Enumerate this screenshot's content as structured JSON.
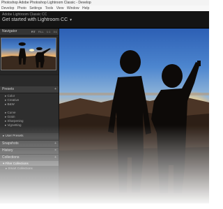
{
  "window": {
    "title": "Photoshop Adobe Photoshop Lightroom Classic - Develop",
    "menu": [
      "Develop",
      "Photo",
      "Settings",
      "Tools",
      "View",
      "Window",
      "Help"
    ]
  },
  "identity": {
    "subtitle": "Adobe Lightroom Classic CC",
    "title": "Get started with Lightroom CC"
  },
  "navigator": {
    "label": "Navigator",
    "zoom": [
      "FIT",
      "FILL",
      "1:1",
      "3:1"
    ],
    "zoom_active": "FIT"
  },
  "presets": {
    "label": "Presets",
    "add": "+",
    "items": [
      {
        "label": "Color",
        "child": true
      },
      {
        "label": "Creative",
        "child": true
      },
      {
        "label": "B&W",
        "child": true
      },
      {
        "label": "",
        "child": false
      },
      {
        "label": "Curve",
        "child": true
      },
      {
        "label": "Grain",
        "child": true
      },
      {
        "label": "Sharpening",
        "child": true
      },
      {
        "label": "Vignetting",
        "child": true
      }
    ],
    "user_presets": "User Presets"
  },
  "panels": [
    {
      "label": "Snapshots",
      "arrow": "+"
    },
    {
      "label": "History",
      "arrow": "×"
    },
    {
      "label": "Collections",
      "arrow": "+"
    }
  ],
  "collections": [
    {
      "label": "Filter Collections",
      "selected": true
    },
    {
      "label": "Smart Collections",
      "selected": false
    }
  ],
  "colors": {
    "panel_bg": "#2b2b2b",
    "header_bg": "#3d3d3d",
    "sky_top": "#2e62b6",
    "sunset": "#ffb347"
  }
}
